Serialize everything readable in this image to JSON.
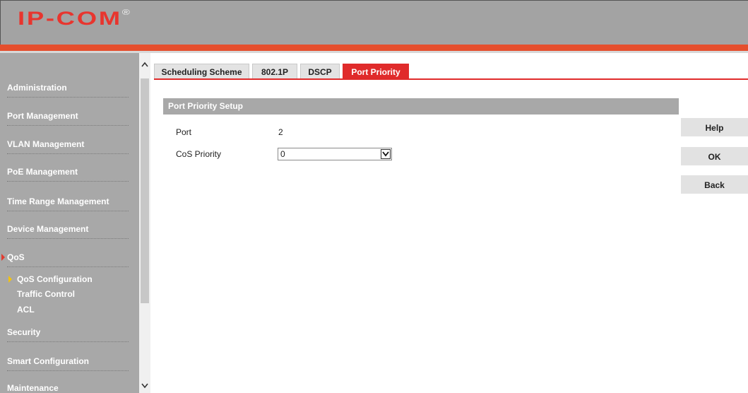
{
  "header": {
    "logo": "IP-COM",
    "logo_mark": "®"
  },
  "sidebar": {
    "items": [
      {
        "label": "Administration"
      },
      {
        "label": "Port Management"
      },
      {
        "label": "VLAN Management"
      },
      {
        "label": "PoE Management"
      },
      {
        "label": "Time Range Management"
      },
      {
        "label": "Device Management"
      },
      {
        "label": "QoS",
        "active": true
      },
      {
        "label": "Security"
      },
      {
        "label": "Smart Configuration"
      },
      {
        "label": "Maintenance"
      }
    ],
    "sub_items": [
      {
        "label": "QoS Configuration",
        "active": true
      },
      {
        "label": "Traffic Control"
      },
      {
        "label": "ACL"
      }
    ],
    "scroll_up_icon": "chevron-up-icon",
    "scroll_down_icon": "chevron-down-icon"
  },
  "tabs": [
    {
      "label": "Scheduling Scheme"
    },
    {
      "label": "802.1P"
    },
    {
      "label": "DSCP"
    },
    {
      "label": "Port Priority",
      "active": true
    }
  ],
  "panel": {
    "title": "Port Priority Setup",
    "port_label": "Port",
    "port_value": "2",
    "cos_label": "CoS Priority",
    "cos_value": "0"
  },
  "buttons": {
    "help": "Help",
    "ok": "OK",
    "back": "Back"
  },
  "colors": {
    "accent": "#e02b2b",
    "sidebar": "#a8a8a8",
    "header": "#a3a3a3",
    "logo": "#e8352e"
  }
}
